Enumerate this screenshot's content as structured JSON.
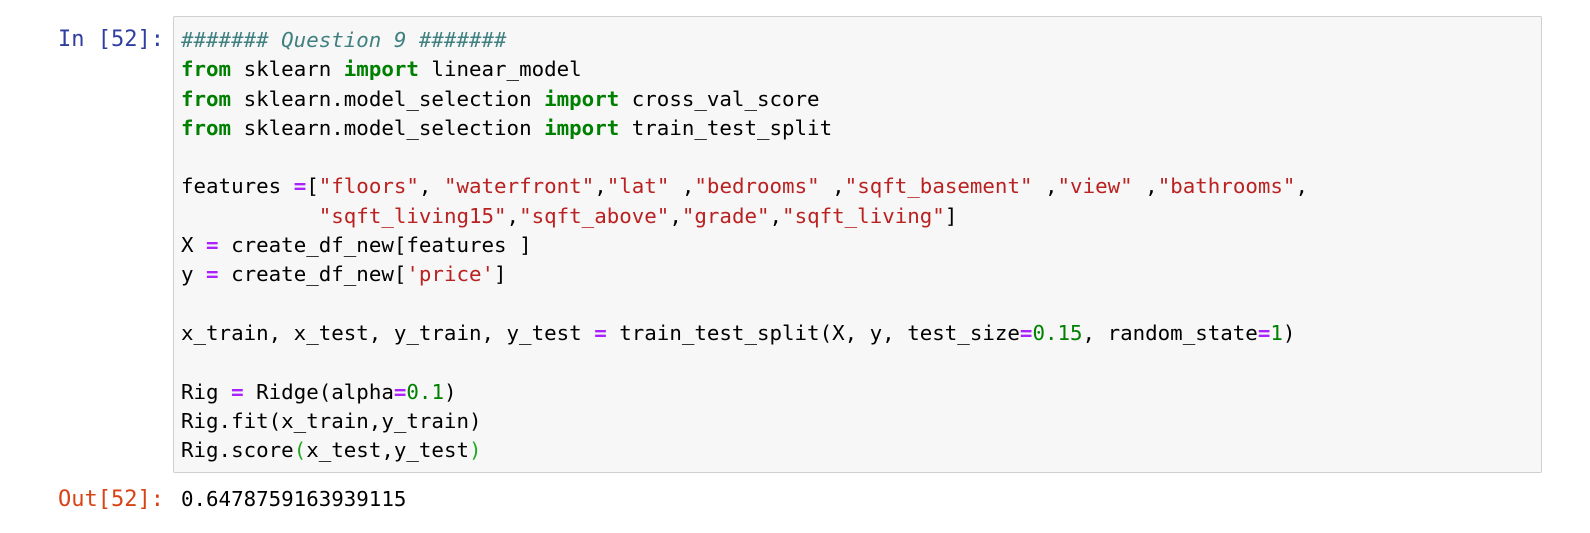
{
  "cell": {
    "in_prompt": "In [52]:",
    "out_prompt": "Out[52]:",
    "output_value": "0.6478759163939115"
  },
  "code_lines": [
    [
      {
        "t": "####### Question 9 #######",
        "k": "comment"
      }
    ],
    [
      {
        "t": "from",
        "k": "keyword"
      },
      {
        "t": " sklearn "
      },
      {
        "t": "import",
        "k": "keyword"
      },
      {
        "t": " linear_model"
      }
    ],
    [
      {
        "t": "from",
        "k": "keyword"
      },
      {
        "t": " sklearn.model_selection "
      },
      {
        "t": "import",
        "k": "keyword"
      },
      {
        "t": " cross_val_score"
      }
    ],
    [
      {
        "t": "from",
        "k": "keyword"
      },
      {
        "t": " sklearn.model_selection "
      },
      {
        "t": "import",
        "k": "keyword"
      },
      {
        "t": " train_test_split"
      }
    ],
    [],
    [
      {
        "t": "features "
      },
      {
        "t": "=",
        "k": "op"
      },
      {
        "t": "["
      },
      {
        "t": "\"floors\"",
        "k": "string"
      },
      {
        "t": ", "
      },
      {
        "t": "\"waterfront\"",
        "k": "string"
      },
      {
        "t": ","
      },
      {
        "t": "\"lat\"",
        "k": "string"
      },
      {
        "t": " ,"
      },
      {
        "t": "\"bedrooms\"",
        "k": "string"
      },
      {
        "t": " ,"
      },
      {
        "t": "\"sqft_basement\"",
        "k": "string"
      },
      {
        "t": " ,"
      },
      {
        "t": "\"view\"",
        "k": "string"
      },
      {
        "t": " ,"
      },
      {
        "t": "\"bathrooms\"",
        "k": "string"
      },
      {
        "t": ","
      }
    ],
    [
      {
        "t": "           "
      },
      {
        "t": "\"sqft_living15\"",
        "k": "string"
      },
      {
        "t": ","
      },
      {
        "t": "\"sqft_above\"",
        "k": "string"
      },
      {
        "t": ","
      },
      {
        "t": "\"grade\"",
        "k": "string"
      },
      {
        "t": ","
      },
      {
        "t": "\"sqft_living\"",
        "k": "string"
      },
      {
        "t": "]"
      }
    ],
    [
      {
        "t": "X "
      },
      {
        "t": "=",
        "k": "op"
      },
      {
        "t": " create_df_new[features ]"
      }
    ],
    [
      {
        "t": "y "
      },
      {
        "t": "=",
        "k": "op"
      },
      {
        "t": " create_df_new["
      },
      {
        "t": "'price'",
        "k": "string"
      },
      {
        "t": "]"
      }
    ],
    [],
    [
      {
        "t": "x_train, x_test, y_train, y_test "
      },
      {
        "t": "=",
        "k": "op"
      },
      {
        "t": " train_test_split(X, y, test_size"
      },
      {
        "t": "=",
        "k": "op"
      },
      {
        "t": "0.15",
        "k": "number"
      },
      {
        "t": ", random_state"
      },
      {
        "t": "=",
        "k": "op"
      },
      {
        "t": "1",
        "k": "number"
      },
      {
        "t": ")"
      }
    ],
    [],
    [
      {
        "t": "Rig "
      },
      {
        "t": "=",
        "k": "op"
      },
      {
        "t": " Ridge(alpha"
      },
      {
        "t": "=",
        "k": "op"
      },
      {
        "t": "0.1",
        "k": "number"
      },
      {
        "t": ")"
      }
    ],
    [
      {
        "t": "Rig.fit(x_train,y_train)"
      }
    ],
    [
      {
        "t": "Rig.score"
      },
      {
        "t": "(",
        "k": "paren"
      },
      {
        "t": "x_test,y_test"
      },
      {
        "t": ")",
        "k": "paren"
      }
    ]
  ]
}
